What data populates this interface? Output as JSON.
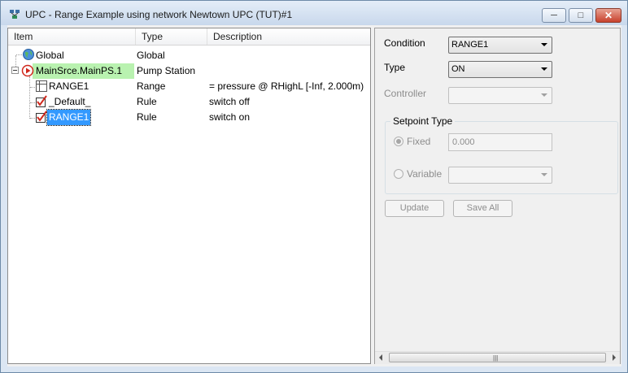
{
  "window": {
    "title": "UPC - Range Example using network Newtown UPC (TUT)#1",
    "icon": "app-network-icon"
  },
  "tree": {
    "columns": [
      "Item",
      "Type",
      "Description"
    ],
    "rows": [
      {
        "item": "Global",
        "type": "Global",
        "description": "",
        "icon": "globe-icon"
      },
      {
        "item": "MainSrce.MainPS.1",
        "type": "Pump Station",
        "description": "",
        "icon": "pump-station-icon"
      },
      {
        "item": "RANGE1",
        "type": "Range",
        "description": "= pressure @ RHighL [-Inf, 2.000m)",
        "icon": "range-grid-icon"
      },
      {
        "item": "_Default_",
        "type": "Rule",
        "description": "switch off",
        "icon": "checkbox-checked-icon"
      },
      {
        "item": "RANGE1",
        "type": "Rule",
        "description": "switch on",
        "icon": "checkbox-checked-icon"
      }
    ]
  },
  "form": {
    "condition_label": "Condition",
    "condition_value": "RANGE1",
    "type_label": "Type",
    "type_value": "ON",
    "controller_label": "Controller",
    "controller_value": "",
    "setpoint_group_label": "Setpoint Type",
    "fixed_label": "Fixed",
    "fixed_value": "0.000",
    "variable_label": "Variable",
    "variable_value": "",
    "update_button": "Update",
    "save_all_button": "Save All"
  },
  "colors": {
    "selected_pump_highlight": "#b9f2b0",
    "selection_blue": "#3399ff",
    "close_button_red": "#c8412c"
  }
}
